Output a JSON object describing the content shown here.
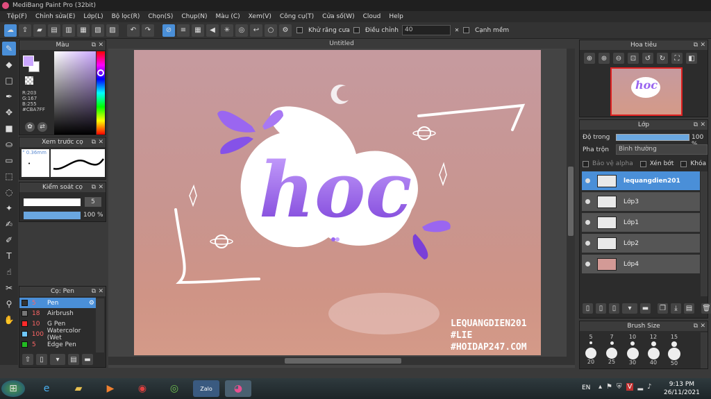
{
  "window": {
    "title": "MediBang Paint Pro (32bit)"
  },
  "menu": [
    "Tệp(F)",
    "Chỉnh sửa(E)",
    "Lớp(L)",
    "Bộ lọc(R)",
    "Chọn(S)",
    "Chụp(N)",
    "Màu (C)",
    "Xem(V)",
    "Công cụ(T)",
    "Cửa số(W)",
    "Cloud",
    "Help"
  ],
  "toolbar": {
    "antialias": "Khử răng cưa",
    "adjust": "Điều chỉnh",
    "adjust_value": "40",
    "smooth": "Cạnh mềm"
  },
  "color_panel": {
    "title": "Màu",
    "r": "R:203",
    "g": "G:167",
    "b": "B:255",
    "hex": "#CBA7FF",
    "primary": "#cba7ff"
  },
  "brush_preview": {
    "title": "Xem trước cọ",
    "size": "° 0.36mm",
    "dot": "•"
  },
  "brush_control": {
    "title": "Kiểm soát cọ",
    "size_btn": "5",
    "opacity": "100 %"
  },
  "pen_panel": {
    "title": "Cọ: Pen",
    "items": [
      {
        "num": "5",
        "name": "Pen",
        "color": "#4a8fd8"
      },
      {
        "num": "18",
        "name": "Airbrush",
        "color": "#777777"
      },
      {
        "num": "10",
        "name": "G Pen",
        "color": "#ff2a2a"
      },
      {
        "num": "100",
        "name": "Watercolor (Wet",
        "color": "#6fc8ff"
      },
      {
        "num": "5",
        "name": "Edge Pen",
        "color": "#22bb22"
      }
    ]
  },
  "document": {
    "tab": "Untitled",
    "watermark": [
      "LEQUANGDIEN201",
      "#LIE",
      "#HOIDAP247.COM"
    ],
    "art_text": "hoc"
  },
  "navigator": {
    "title": "Hoa tiêu"
  },
  "layers": {
    "title": "Lớp",
    "opacity_label": "Độ trong",
    "opacity_value": "100 %",
    "blend_label": "Pha trộn",
    "blend_value": "Bình thường",
    "alpha_label": "Bảo vệ alpha",
    "clip_label": "Xén bớt",
    "lock_label": "Khóa",
    "items": [
      {
        "name": "lequangdien201"
      },
      {
        "name": "Lớp3"
      },
      {
        "name": "Lớp1"
      },
      {
        "name": "Lớp2"
      },
      {
        "name": "Lớp4"
      }
    ]
  },
  "brush_size": {
    "title": "Brush Size",
    "row1": [
      "5",
      "7",
      "10",
      "12",
      "15"
    ],
    "row2": [
      "20",
      "25",
      "30",
      "40",
      "50"
    ]
  },
  "taskbar": {
    "lang": "EN",
    "time": "9:13 PM",
    "date": "26/11/2021",
    "zalo": "Zalo"
  }
}
